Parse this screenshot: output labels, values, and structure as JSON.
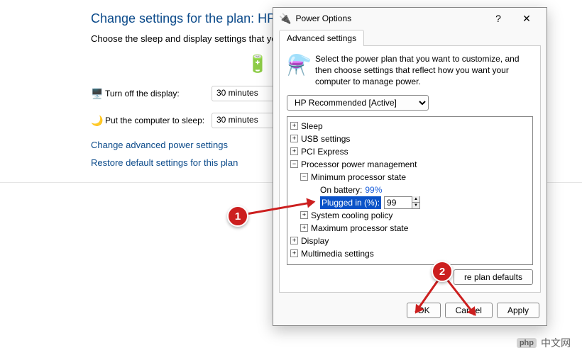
{
  "background": {
    "heading": "Change settings for the plan: HP Re",
    "subtext": "Choose the sleep and display settings that you",
    "display_row": {
      "label": "Turn off the display:",
      "value": "30 minutes"
    },
    "sleep_row": {
      "label": "Put the computer to sleep:",
      "value": "30 minutes"
    },
    "link_advanced": "Change advanced power settings",
    "link_restore": "Restore default settings for this plan"
  },
  "dialog": {
    "title": "Power Options",
    "tab": "Advanced settings",
    "description": "Select the power plan that you want to customize, and then choose settings that reflect how you want your computer to manage power.",
    "plan_selected": "HP Recommended [Active]",
    "restore_defaults_partial": "re plan defaults",
    "buttons": {
      "ok": "OK",
      "cancel": "Cancel",
      "apply": "Apply"
    }
  },
  "tree": {
    "sleep": "Sleep",
    "usb": "USB settings",
    "pci": "PCI Express",
    "proc": "Processor power management",
    "min_state": "Minimum processor state",
    "on_battery_label": "On battery:",
    "on_battery_value": "99%",
    "plugged_label": "Plugged in (%):",
    "plugged_value": "99",
    "cooling": "System cooling policy",
    "max_state": "Maximum processor state",
    "display": "Display",
    "multimedia": "Multimedia settings"
  },
  "annotations": {
    "one": "1",
    "two": "2"
  },
  "watermark": {
    "logo": "php",
    "text": "中文网"
  }
}
